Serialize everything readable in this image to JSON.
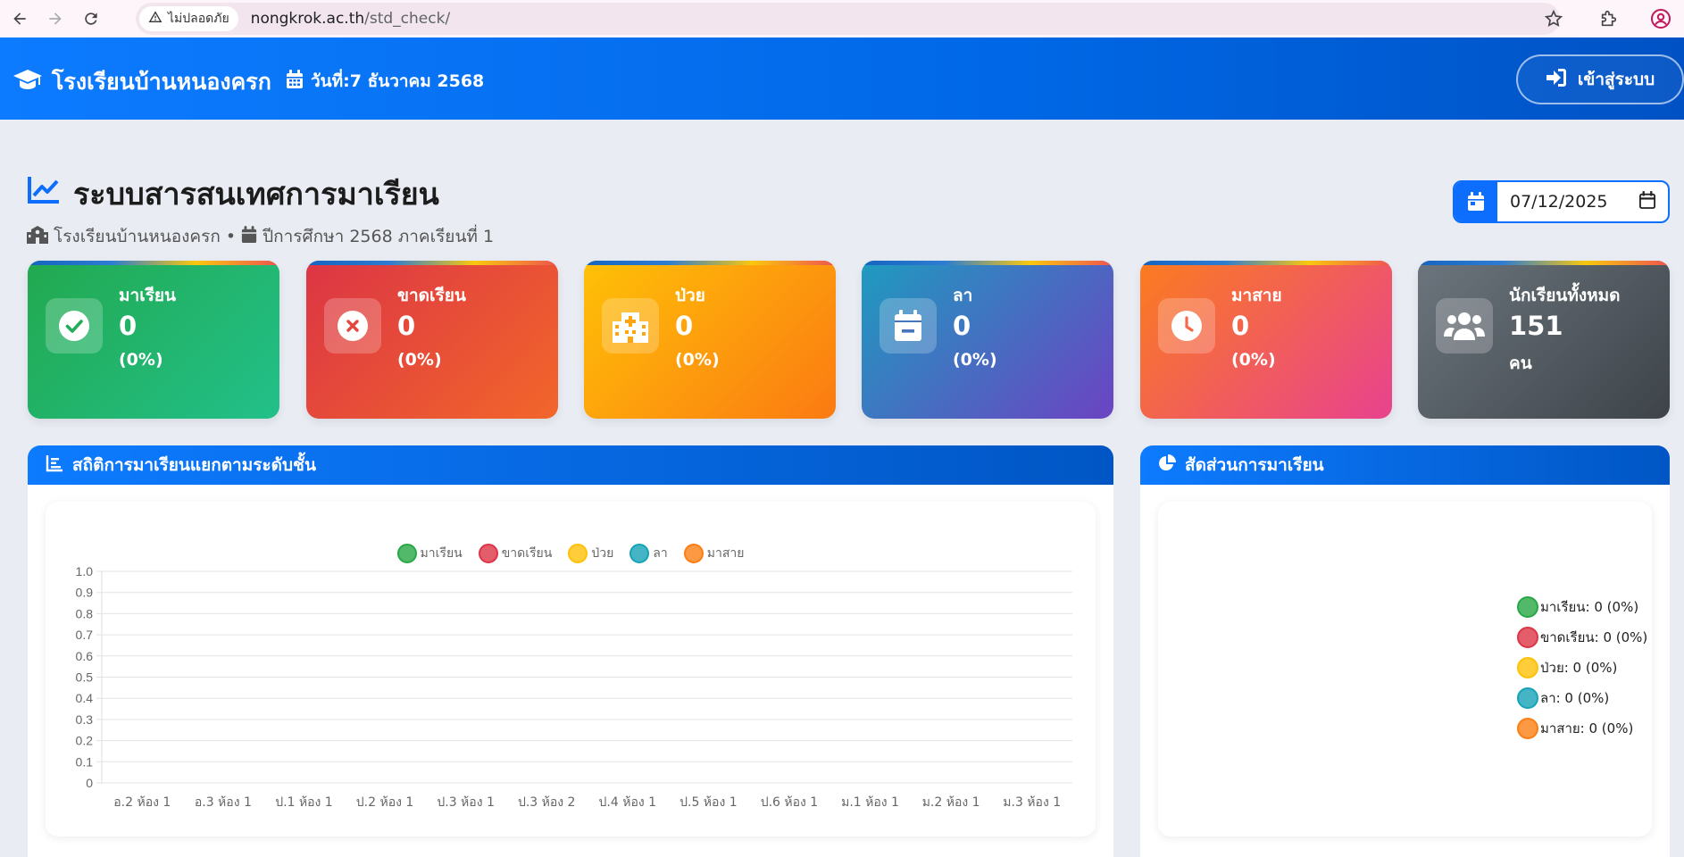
{
  "browser": {
    "security_label": "ไม่ปลอดภัย",
    "url_host": "nongkrok.ac.th",
    "url_path": "/std_check/"
  },
  "header": {
    "school_name": "โรงเรียนบ้านหนองครก",
    "date_text": "วันที่:7 ธันวาคม 2568",
    "login_label": "เข้าสู่ระบบ"
  },
  "page": {
    "title": "ระบบสารสนเทศการมาเรียน",
    "school": "โรงเรียนบ้านหนองครก",
    "separator": "•",
    "academic_year": "ปีการศึกษา 2568 ภาคเรียนที่ 1",
    "date_value": "07/12/2025"
  },
  "cards": [
    {
      "label": "มาเรียน",
      "value": "0",
      "sub": "(0%)"
    },
    {
      "label": "ขาดเรียน",
      "value": "0",
      "sub": "(0%)"
    },
    {
      "label": "ป่วย",
      "value": "0",
      "sub": "(0%)"
    },
    {
      "label": "ลา",
      "value": "0",
      "sub": "(0%)"
    },
    {
      "label": "มาสาย",
      "value": "0",
      "sub": "(0%)"
    },
    {
      "label": "นักเรียนทั้งหมด",
      "value": "151",
      "sub": "คน"
    }
  ],
  "panels": {
    "bar_title": "สถิติการมาเรียนแยกตามระดับชั้น",
    "pie_title": "สัดส่วนการมาเรียน"
  },
  "colors": {
    "present": "#28a745",
    "absent": "#dc3545",
    "sick": "#ffc107",
    "leave": "#17a2b8",
    "late": "#fd7e14"
  },
  "chart_data": [
    {
      "type": "bar",
      "title": "สถิติการมาเรียนแยกตามระดับชั้น",
      "categories": [
        "อ.2 ห้อง 1",
        "อ.3 ห้อง 1",
        "ป.1 ห้อง 1",
        "ป.2 ห้อง 1",
        "ป.3 ห้อง 1",
        "ป.3 ห้อง 2",
        "ป.4 ห้อง 1",
        "ป.5 ห้อง 1",
        "ป.6 ห้อง 1",
        "ม.1 ห้อง 1",
        "ม.2 ห้อง 1",
        "ม.3 ห้อง 1"
      ],
      "series": [
        {
          "name": "มาเรียน",
          "color": "#28a745",
          "values": [
            0,
            0,
            0,
            0,
            0,
            0,
            0,
            0,
            0,
            0,
            0,
            0
          ]
        },
        {
          "name": "ขาดเรียน",
          "color": "#dc3545",
          "values": [
            0,
            0,
            0,
            0,
            0,
            0,
            0,
            0,
            0,
            0,
            0,
            0
          ]
        },
        {
          "name": "ป่วย",
          "color": "#ffc107",
          "values": [
            0,
            0,
            0,
            0,
            0,
            0,
            0,
            0,
            0,
            0,
            0,
            0
          ]
        },
        {
          "name": "ลา",
          "color": "#17a2b8",
          "values": [
            0,
            0,
            0,
            0,
            0,
            0,
            0,
            0,
            0,
            0,
            0,
            0
          ]
        },
        {
          "name": "มาสาย",
          "color": "#fd7e14",
          "values": [
            0,
            0,
            0,
            0,
            0,
            0,
            0,
            0,
            0,
            0,
            0,
            0
          ]
        }
      ],
      "yticks": [
        "0",
        "0.1",
        "0.2",
        "0.3",
        "0.4",
        "0.5",
        "0.6",
        "0.7",
        "0.8",
        "0.9",
        "1.0"
      ],
      "ylim": [
        0,
        1.0
      ],
      "grid": true,
      "legend": "top"
    },
    {
      "type": "pie",
      "title": "สัดส่วนการมาเรียน",
      "labels": [
        "มาเรียน",
        "ขาดเรียน",
        "ป่วย",
        "ลา",
        "มาสาย"
      ],
      "values": [
        0,
        0,
        0,
        0,
        0
      ],
      "legend_labels": [
        "มาเรียน: 0 (0%)",
        "ขาดเรียน: 0 (0%)",
        "ป่วย: 0 (0%)",
        "ลา: 0 (0%)",
        "มาสาย: 0 (0%)"
      ],
      "colors": [
        "#28a745",
        "#dc3545",
        "#ffc107",
        "#17a2b8",
        "#fd7e14"
      ],
      "legend": "right"
    }
  ]
}
